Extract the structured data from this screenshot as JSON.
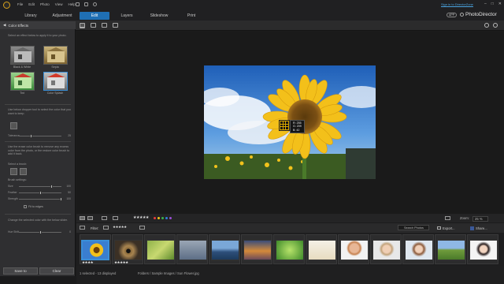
{
  "titlebar": {
    "menu": [
      "File",
      "Edit",
      "Photo",
      "View",
      "Help"
    ],
    "signin": "Sign in to DirectorZone",
    "window_controls": [
      "–",
      "□",
      "✕"
    ]
  },
  "modes": {
    "library": "Library",
    "adjustment": "Adjustment",
    "edit": "Edit",
    "layers": "Layers",
    "slideshow": "Slideshow",
    "print": "Print"
  },
  "brand": {
    "app_badge": "APP",
    "name": "PhotoDirector"
  },
  "panel": {
    "title": "Color Effects",
    "intro": "Select an effect below to apply it to your photo.",
    "effects": [
      "Black & White",
      "Sepia",
      "Tint",
      "Color Splash"
    ],
    "dropper_hint": "Use below dropper tool to select the color that you want to keep.",
    "tolerance_label": "Tolerance",
    "tolerance_value": "25",
    "brush_hint": "Use the erase color brush to remove any excess color from the photo, or the restore color brush to add it back.",
    "select_brush": "Select a brush:",
    "brush_settings": "Brush settings:",
    "size_label": "Size",
    "size_value": "100",
    "feather_label": "Feather",
    "feather_value": "50",
    "strength_label": "Strength",
    "strength_value": "100",
    "fit_edges": "Fit to edges",
    "change_hint": "Change the selected color with the below slider.",
    "hue_label": "Hue Shift",
    "hue_value": "0",
    "save_button": "Save to",
    "clear_button": "Clear"
  },
  "canvas": {
    "rgb_r": "R: 255",
    "rgb_g": "G: 209",
    "rgb_b": "B: 42"
  },
  "strip": {
    "rating": "★★★★★",
    "zoom_label": "Zoom:",
    "zoom_value": "25 %",
    "filter_label": "Filter:",
    "search_placeholder": "Search Photos",
    "export_label": "Export...",
    "share_label": "Share...",
    "color_labels": [
      "#e63b3b",
      "#f0c419",
      "#3ab54a",
      "#2f7fdc",
      "#9b4fd6"
    ]
  },
  "thumbnails": [
    {
      "name": "Sun Flower",
      "stars": "★★★★",
      "selected": true
    },
    {
      "name": "Eye",
      "stars": "★★★★★"
    },
    {
      "name": "Grass",
      "stars": ""
    },
    {
      "name": "Drop",
      "stars": ""
    },
    {
      "name": "Lake",
      "stars": ""
    },
    {
      "name": "Sunset",
      "stars": ""
    },
    {
      "name": "Leaf",
      "stars": ""
    },
    {
      "name": "Beach",
      "stars": ""
    },
    {
      "name": "Portrait 1",
      "stars": ""
    },
    {
      "name": "Portrait 2",
      "stars": ""
    },
    {
      "name": "Portrait 3",
      "stars": ""
    },
    {
      "name": "Field",
      "stars": ""
    },
    {
      "name": "Portrait 4",
      "stars": ""
    }
  ],
  "status": {
    "selection": "1 selected - 13 displayed",
    "path": "Folders / Sample Images / Sun Flower.jpg"
  }
}
